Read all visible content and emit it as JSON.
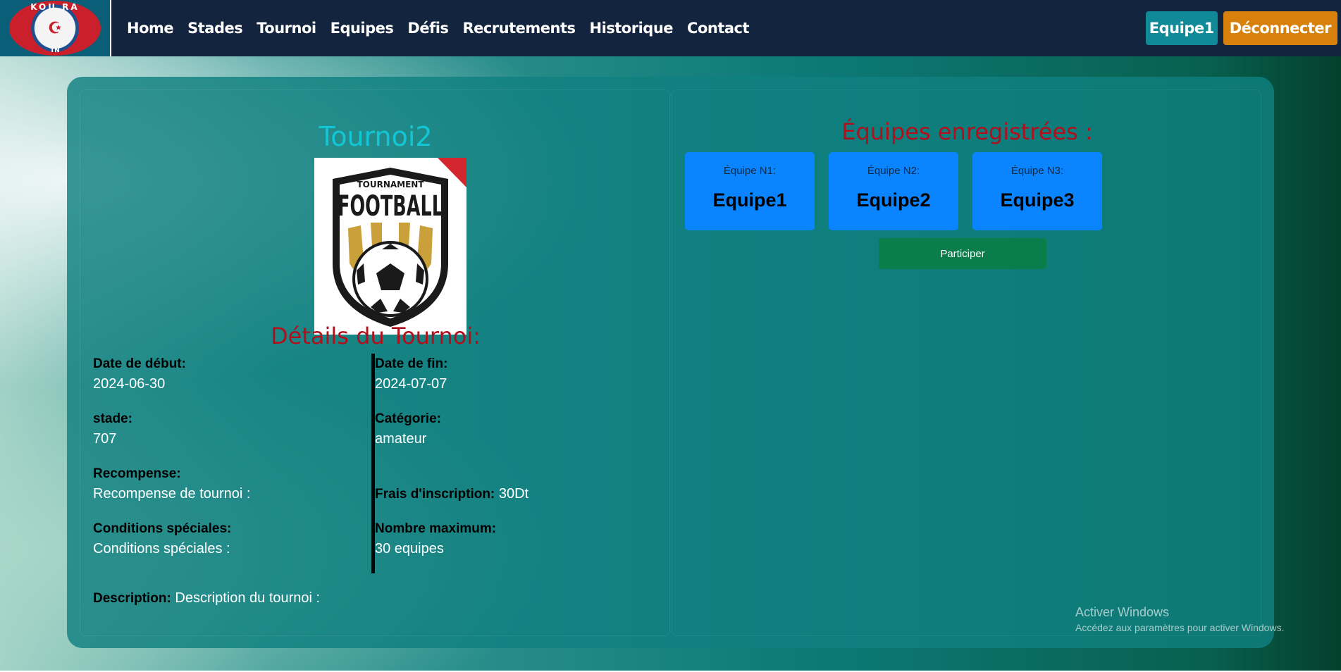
{
  "navbar": {
    "logo": {
      "top_text": "KOU RA",
      "bottom_text": "TN"
    },
    "links": [
      "Home",
      "Stades",
      "Tournoi",
      "Equipes",
      "Défis",
      "Recrutements",
      "Historique",
      "Contact"
    ],
    "team_button": "Equipe1",
    "logout_button": "Déconnecter"
  },
  "tournament": {
    "title": "Tournoi2",
    "image": {
      "line1": "TOURNAMENT",
      "line2": "FOOTBALL"
    },
    "details_title": "Détails du Tournoi:",
    "left": [
      {
        "label": "Date de début:",
        "value": "2024-06-30"
      },
      {
        "label": "stade:",
        "value": "707"
      },
      {
        "label": "Recompense:",
        "value": "Recompense de tournoi :"
      },
      {
        "label": "Conditions spéciales:",
        "value": "Conditions spéciales :"
      }
    ],
    "right": [
      {
        "label": "Date de fin:",
        "value": "2024-07-07"
      },
      {
        "label": "Catégorie:",
        "value": "amateur"
      },
      {
        "label": "Frais d'inscription:",
        "value": "30Dt"
      },
      {
        "label": "Nombre maximum:",
        "value": "30 equipes"
      }
    ],
    "description_label": "Description:",
    "description_value": "Description du tournoi :"
  },
  "teams_panel": {
    "title": "Équipes enregistrées :",
    "teams": [
      {
        "number": "Équipe N1:",
        "name": "Equipe1"
      },
      {
        "number": "Équipe N2:",
        "name": "Equipe2"
      },
      {
        "number": "Équipe N3:",
        "name": "Equipe3"
      }
    ],
    "participate_button": "Participer"
  },
  "watermark": {
    "title": "Activer Windows",
    "subtitle": "Accédez aux paramètres pour activer Windows."
  },
  "colors": {
    "navbar_bg": "#13243e",
    "team_button": "#0f8a96",
    "logout_button": "#d8800c",
    "title_cyan": "#12c6d6",
    "section_red": "#b0101c",
    "team_card": "#0a84ff",
    "participate_button": "#0a7d4a"
  }
}
